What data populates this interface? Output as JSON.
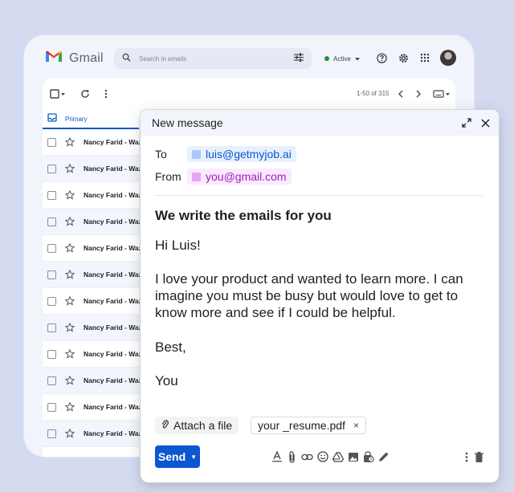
{
  "gmail": {
    "brand": "Gmail",
    "search_placeholder": "Search in emails",
    "status": "Active",
    "pager": "1-50 of 315",
    "tab_primary": "Primary",
    "rows": [
      {
        "sender": "Nancy Farid - Wazz"
      },
      {
        "sender": "Nancy Farid - Wazz"
      },
      {
        "sender": "Nancy Farid - Wazz"
      },
      {
        "sender": "Nancy Farid - Wazz"
      },
      {
        "sender": "Nancy Farid - Wazz"
      },
      {
        "sender": "Nancy Farid - Wazz"
      },
      {
        "sender": "Nancy Farid - Wazz"
      },
      {
        "sender": "Nancy Farid - Wazz"
      },
      {
        "sender": "Nancy Farid - Wazz"
      },
      {
        "sender": "Nancy Farid - Wazz"
      },
      {
        "sender": "Nancy Farid - Wazz"
      },
      {
        "sender": "Nancy Farid - Wazz"
      }
    ]
  },
  "compose": {
    "title": "New message",
    "to_label": "To",
    "to_value": "luis@getmyjob.ai",
    "from_label": "From",
    "from_value": "you@gmail.com",
    "subject": "We write the emails for you",
    "greeting": "Hi Luis!",
    "body": "I love your product and wanted to learn more. I can imagine you must be busy but would love to get to know more and see if I could be helpful.",
    "signoff": "Best,",
    "signature": "You",
    "attach_label": "Attach a file",
    "attachment_name": "your _resume.pdf",
    "attachment_remove": "×",
    "send_label": "Send"
  },
  "colors": {
    "background": "#d4daf0",
    "send_button": "#0b57d0",
    "to_chip": "#e8f0fe",
    "from_chip": "#fbe9fd"
  },
  "icons": [
    "gmail-logo-icon",
    "search-icon",
    "filter-icon",
    "help-icon",
    "gear-icon",
    "apps-icon",
    "checkbox-icon",
    "refresh-icon",
    "more-vert-icon",
    "chevron-left-icon",
    "chevron-right-icon",
    "keyboard-icon",
    "inbox-icon",
    "star-icon",
    "expand-icon",
    "close-icon",
    "paperclip-icon",
    "format-text-icon",
    "link-icon",
    "emoji-icon",
    "drive-icon",
    "image-icon",
    "lock-clock-icon",
    "pen-icon",
    "trash-icon"
  ]
}
